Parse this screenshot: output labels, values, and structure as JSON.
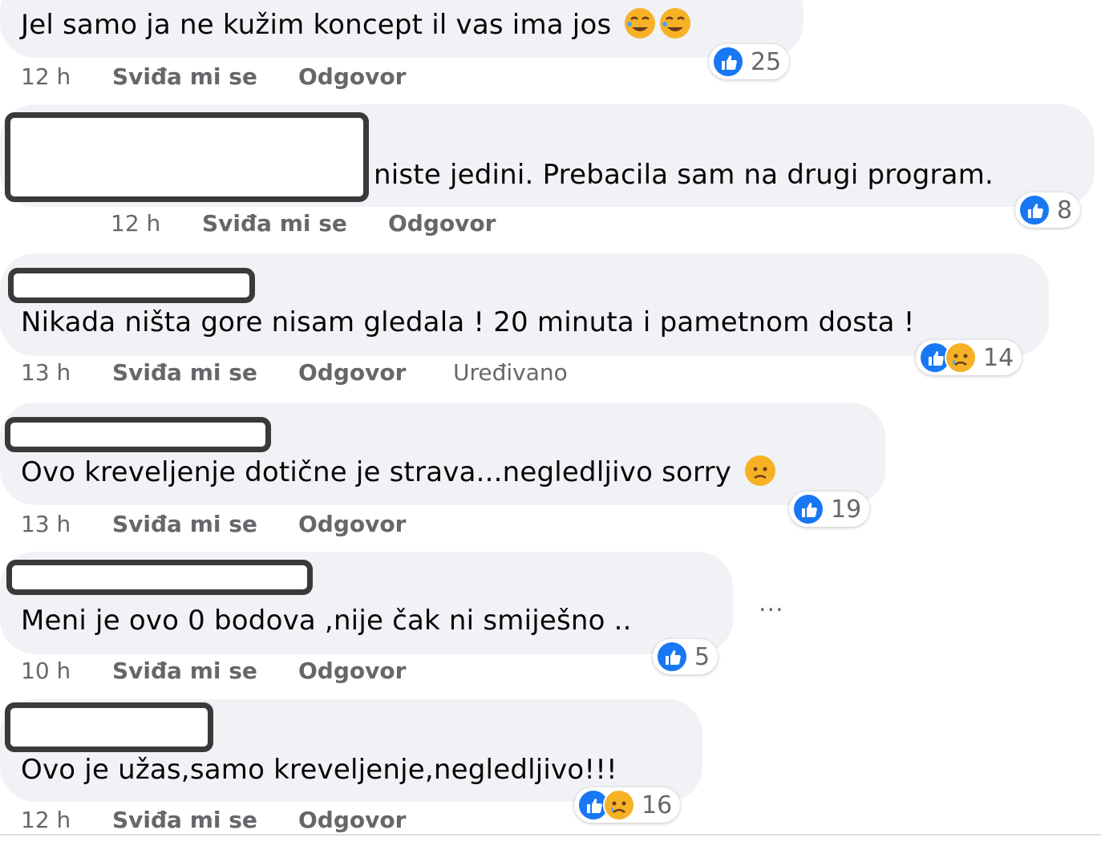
{
  "colors": {
    "bubble": "#f0f2f5",
    "like_blue": "#1877f2",
    "emoji_yellow": "#f7b125",
    "meta_gray": "#65676b",
    "text": "#050505"
  },
  "comments": [
    {
      "text": "Jel samo ja ne kužim koncept il vas ima jos",
      "inline_emojis": [
        "rofl-emoji",
        "rofl-emoji"
      ],
      "time": "12 h",
      "like_label": "Sviđa mi se",
      "reply_label": "Odgovor",
      "reactions": [
        "like-icon"
      ],
      "reaction_count": "25"
    },
    {
      "text": "niste jedini. Prebacila sam na drugi program.",
      "time": "12 h",
      "like_label": "Sviđa mi se",
      "reply_label": "Odgovor",
      "reactions": [
        "like-icon"
      ],
      "reaction_count": "8"
    },
    {
      "text": "Nikada ništa gore nisam gledala ! 20 minuta i pametnom dosta !",
      "time": "13 h",
      "like_label": "Sviđa mi se",
      "reply_label": "Odgovor",
      "edited_label": "Uređivano",
      "reactions": [
        "like-icon",
        "sad-icon"
      ],
      "reaction_count": "14"
    },
    {
      "text": "Ovo kreveljenje dotične je strava...negledljivo sorry",
      "inline_emojis": [
        "disappointed-emoji"
      ],
      "time": "13 h",
      "like_label": "Sviđa mi se",
      "reply_label": "Odgovor",
      "reactions": [
        "like-icon"
      ],
      "reaction_count": "19"
    },
    {
      "text": "Meni je ovo 0 bodova ,nije čak ni smiješno ..",
      "time": "10 h",
      "like_label": "Sviđa mi se",
      "reply_label": "Odgovor",
      "reactions": [
        "like-icon"
      ],
      "reaction_count": "5"
    },
    {
      "text": "Ovo je užas,samo kreveljenje,negledljivo!!!",
      "time": "12 h",
      "like_label": "Sviđa mi se",
      "reply_label": "Odgovor",
      "reactions": [
        "like-icon",
        "sad-icon"
      ],
      "reaction_count": "16"
    }
  ],
  "more_options_label": "..."
}
